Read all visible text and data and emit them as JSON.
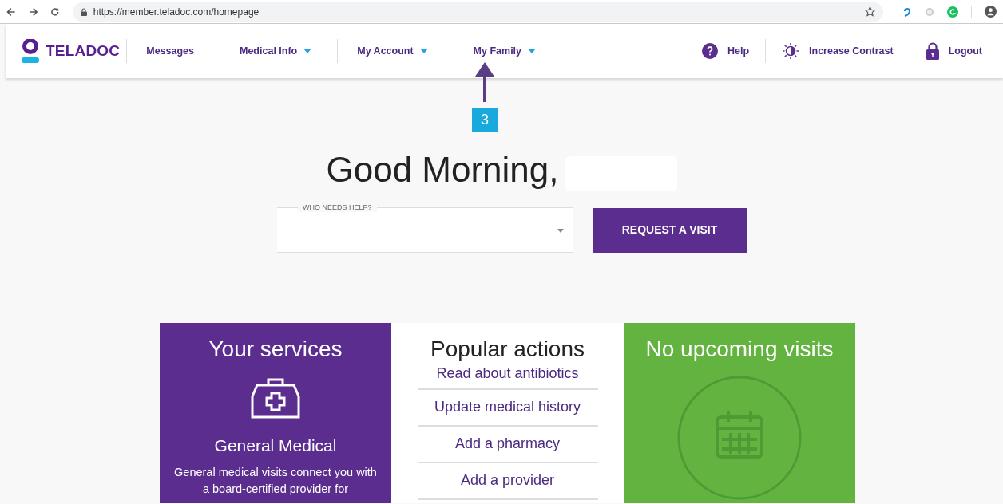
{
  "browser": {
    "url": "https://member.teladoc.com/homepage"
  },
  "nav": {
    "logo": "TELADOC",
    "items": [
      {
        "label": "Messages",
        "dropdown": false
      },
      {
        "label": "Medical Info",
        "dropdown": true
      },
      {
        "label": "My Account",
        "dropdown": true
      },
      {
        "label": "My Family",
        "dropdown": true
      }
    ],
    "right": [
      {
        "label": "Help",
        "kind": "help"
      },
      {
        "label": "Increase Contrast",
        "kind": "contrast"
      },
      {
        "label": "Logout",
        "kind": "lock"
      }
    ]
  },
  "annotation": {
    "number": "3"
  },
  "greeting": "Good Morning,",
  "who_field": {
    "label": "WHO NEEDS HELP?"
  },
  "request_button": "REQUEST A VISIT",
  "services": {
    "title": "Your services",
    "service_name": "General Medical",
    "description": "General medical visits connect you with a board-certified provider for"
  },
  "popular": {
    "title": "Popular actions",
    "actions": [
      "Read about antibiotics",
      "Update medical history",
      "Add a pharmacy",
      "Add a provider"
    ]
  },
  "visits": {
    "title": "No upcoming visits"
  }
}
